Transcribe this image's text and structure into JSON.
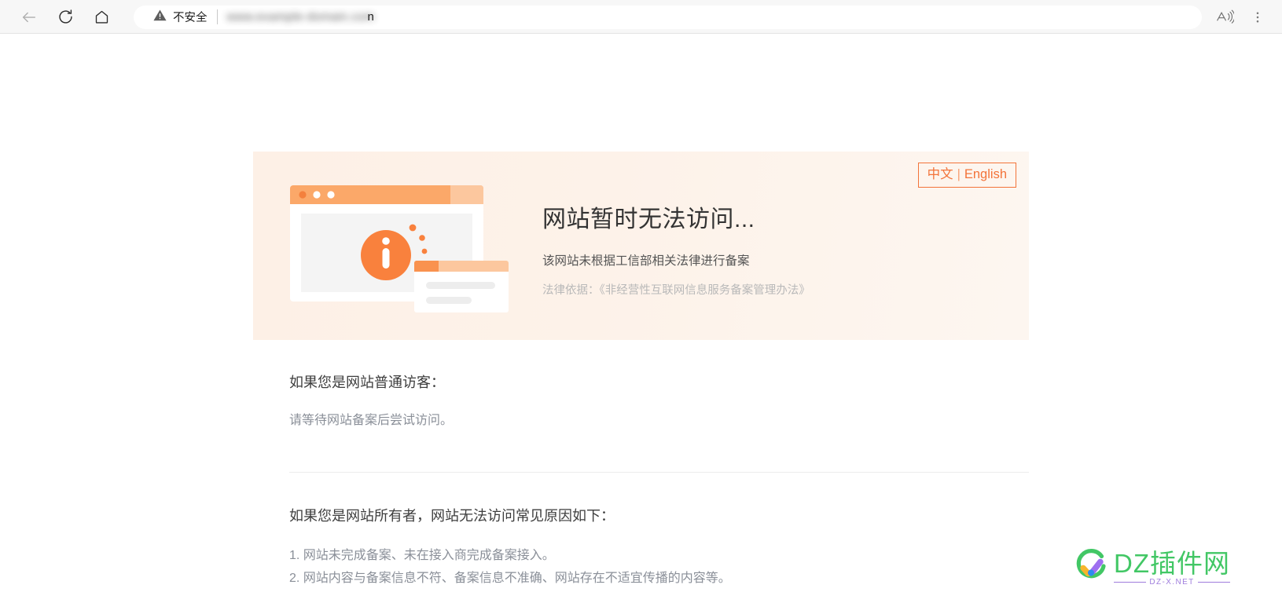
{
  "browser": {
    "back_icon": "back-arrow-icon",
    "reload_icon": "reload-icon",
    "home_icon": "home-icon",
    "security_icon": "warning-triangle-icon",
    "security_label": "不安全",
    "url_blurred": "www.example-domain.com",
    "url_visible_tail": "n",
    "read_aloud_icon": "read-aloud-icon",
    "more_icon": "more-options-icon"
  },
  "hero": {
    "lang_toggle": {
      "chinese": "中文",
      "separator": "|",
      "english": "English"
    },
    "title": "网站暂时无法访问...",
    "subtitle": "该网站未根据工信部相关法律进行备案",
    "legal_label": "法律依据：",
    "legal_reference": "《非经营性互联网信息服务备案管理办法》",
    "illustration_icon": "info-circle-icon"
  },
  "visitor_section": {
    "heading": "如果您是网站普通访客：",
    "body": "请等待网站备案后尝试访问。"
  },
  "owner_section": {
    "heading": "如果您是网站所有者，网站无法访问常见原因如下：",
    "reasons": [
      "1. 网站未完成备案、未在接入商完成备案接入。",
      "2. 网站内容与备案信息不符、备案信息不准确、网站存在不适宜传播的内容等。"
    ]
  },
  "watermark": {
    "logo_icon": "check-circle-logo-icon",
    "brand": "DZ插件网",
    "domain": "DZ-X.NET"
  },
  "colors": {
    "accent_orange": "#f3743a",
    "hero_bg": "#fdf0e6",
    "brand_green": "#42c765",
    "brand_purple": "#9f7ddd",
    "muted_text": "#8a8f98"
  }
}
